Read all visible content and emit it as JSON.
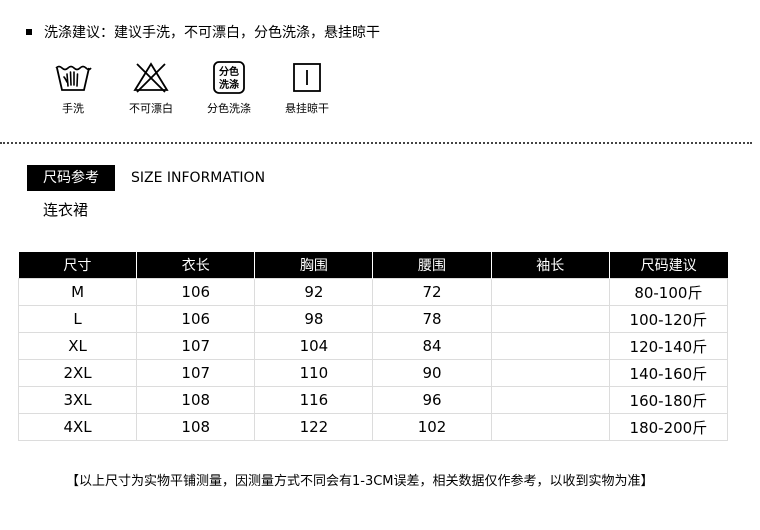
{
  "care": {
    "line": "洗涤建议：建议手洗，不可漂白，分色洗涤，悬挂晾干",
    "icons": [
      {
        "icon": "hand-wash-icon",
        "label": "手洗"
      },
      {
        "icon": "no-bleach-icon",
        "label": "不可漂白"
      },
      {
        "icon": "wash-separately-icon",
        "label": "分色洗涤",
        "glyph_top": "分色",
        "glyph_bottom": "洗涤"
      },
      {
        "icon": "hang-dry-icon",
        "label": "悬挂晾干"
      }
    ]
  },
  "size_section": {
    "tag": "尺码参考",
    "title_en": "SIZE INFORMATION",
    "product": "连衣裙"
  },
  "table": {
    "headers": [
      "尺寸",
      "衣长",
      "胸围",
      "腰围",
      "袖长",
      "尺码建议"
    ],
    "rows": [
      [
        "M",
        "106",
        "92",
        "72",
        "",
        "80-100斤"
      ],
      [
        "L",
        "106",
        "98",
        "78",
        "",
        "100-120斤"
      ],
      [
        "XL",
        "107",
        "104",
        "84",
        "",
        "120-140斤"
      ],
      [
        "2XL",
        "107",
        "110",
        "90",
        "",
        "140-160斤"
      ],
      [
        "3XL",
        "108",
        "116",
        "96",
        "",
        "160-180斤"
      ],
      [
        "4XL",
        "108",
        "122",
        "102",
        "",
        "180-200斤"
      ]
    ]
  },
  "note": "【以上尺寸为实物平铺测量，因测量方式不同会有1-3CM误差，相关数据仅作参考，以收到实物为准】"
}
